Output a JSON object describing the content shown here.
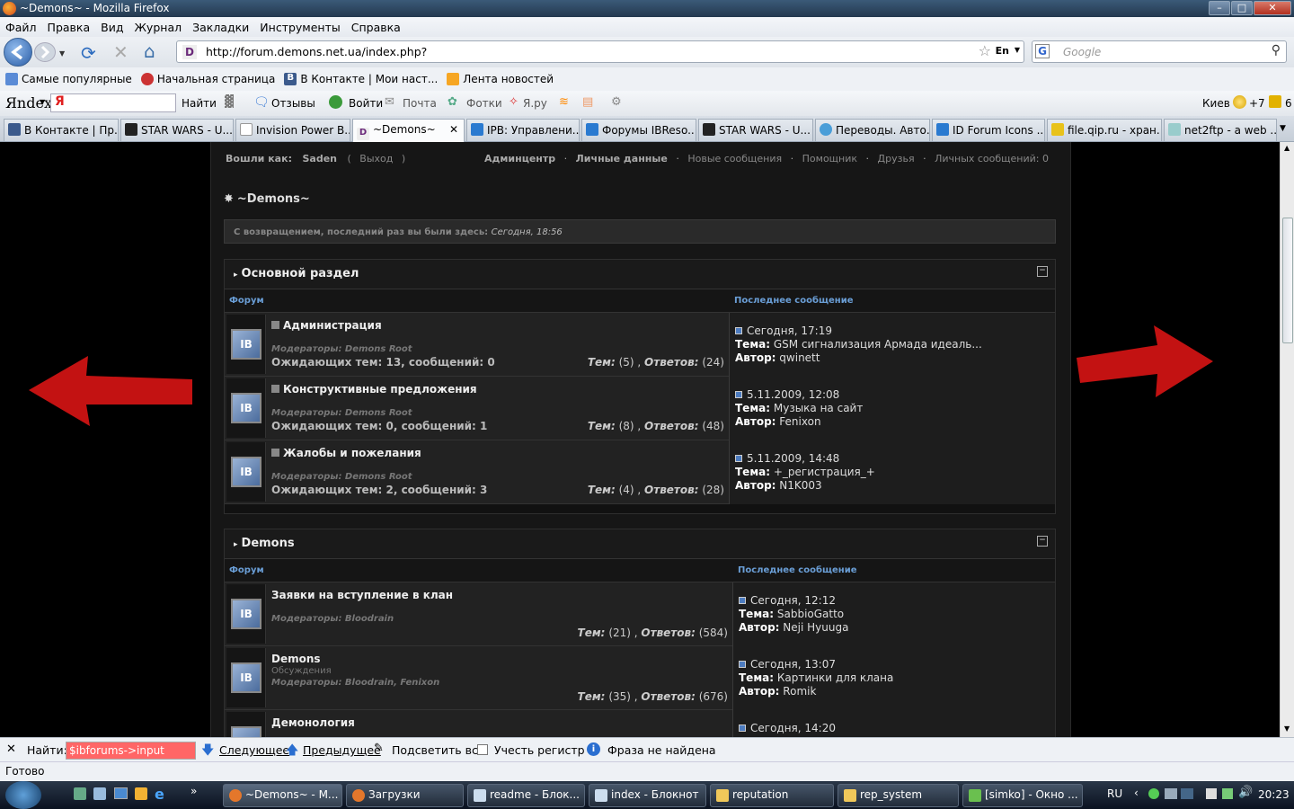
{
  "window": {
    "title": "~Demons~ - Mozilla Firefox"
  },
  "menu": [
    "Файл",
    "Правка",
    "Вид",
    "Журнал",
    "Закладки",
    "Инструменты",
    "Справка"
  ],
  "address": {
    "url": "http://forum.demons.net.ua/index.php?",
    "lang": "En"
  },
  "search": {
    "placeholder": "Google"
  },
  "bookmarks": [
    "Самые популярные",
    "Начальная страница",
    "В Контакте | Мои наст...",
    "Лента новостей"
  ],
  "yandex": {
    "logo": "Яndex",
    "ya": "Я",
    "find": "Найти",
    "reviews": "Отзывы",
    "login": "Войти",
    "mail": "Почта",
    "photos": "Фотки",
    "yaru": "Я.ру",
    "city": "Киев",
    "temp": "+7",
    "count": "6"
  },
  "tabs": [
    {
      "label": "В Контакте | Пр..."
    },
    {
      "label": "STAR WARS - U..."
    },
    {
      "label": "Invision Power B..."
    },
    {
      "label": "~Demons~"
    },
    {
      "label": "IPB: Управлени..."
    },
    {
      "label": "Форумы IBReso..."
    },
    {
      "label": "STAR WARS - U..."
    },
    {
      "label": "Переводы. Авто..."
    },
    {
      "label": "ID Forum Icons ..."
    },
    {
      "label": "file.qip.ru - хран..."
    },
    {
      "label": "net2ftp - a web ..."
    }
  ],
  "userbar": {
    "logged_label": "Вошли как:",
    "user": "Saden",
    "paren_open": "(",
    "logout": "Выход",
    "paren_close": ")",
    "admin": "Админцентр",
    "personal": "Личные данные",
    "new_posts": "Новые сообщения",
    "helper": "Помощник",
    "friends": "Друзья",
    "pm": "Личных сообщений: 0",
    "sep": "·"
  },
  "brand": "~Demons~",
  "welcome": {
    "text": "С возвращением, последний раз вы были здесь:",
    "time": "Сегодня, 18:56"
  },
  "categories": [
    {
      "title": "Основной раздел",
      "col_forum": "Форум",
      "col_last": "Последнее сообщение",
      "forums": [
        {
          "name": "Администрация",
          "mods": "Модераторы: Demons Root",
          "waiting": "Ожидающих тем: 13, сообщений: 0",
          "topics_label": "Тем:",
          "topics": "(5)",
          "replies_label": "Ответов:",
          "replies": "(24)",
          "last_date": "Сегодня, 17:19",
          "topic_label": "Тема:",
          "last_topic": "GSM сигнализация Армада идеаль...",
          "author_label": "Автор:",
          "last_author": "qwinett"
        },
        {
          "name": "Конструктивные предложения",
          "mods": "Модераторы: Demons Root",
          "waiting": "Ожидающих тем: 0, сообщений: 1",
          "topics_label": "Тем:",
          "topics": "(8)",
          "replies_label": "Ответов:",
          "replies": "(48)",
          "last_date": "5.11.2009, 12:08",
          "topic_label": "Тема:",
          "last_topic": "Музыка на сайт",
          "author_label": "Автор:",
          "last_author": "Fenixon"
        },
        {
          "name": "Жалобы и пожелания",
          "mods": "Модераторы: Demons Root",
          "waiting": "Ожидающих тем: 2, сообщений: 3",
          "topics_label": "Тем:",
          "topics": "(4)",
          "replies_label": "Ответов:",
          "replies": "(28)",
          "last_date": "5.11.2009, 14:48",
          "topic_label": "Тема:",
          "last_topic": "+_регистрация_+",
          "author_label": "Автор:",
          "last_author": "N1K003"
        }
      ]
    },
    {
      "title": "Demons",
      "col_forum": "Форум",
      "col_last": "Последнее сообщение",
      "forums": [
        {
          "name": "Заявки на вступление в клан",
          "mods": "Модераторы: Bloodrain",
          "topics_label": "Тем:",
          "topics": "(21)",
          "replies_label": "Ответов:",
          "replies": "(584)",
          "last_date": "Сегодня, 12:12",
          "topic_label": "Тема:",
          "last_topic": "SabbioGatto",
          "author_label": "Автор:",
          "last_author": "Neji Hyuuga"
        },
        {
          "name": "Demons",
          "desc": "Обсуждения",
          "mods": "Модераторы: Bloodrain, Fenixon",
          "topics_label": "Тем:",
          "topics": "(35)",
          "replies_label": "Ответов:",
          "replies": "(676)",
          "last_date": "Сегодня, 13:07",
          "topic_label": "Тема:",
          "last_topic": "Картинки для клана",
          "author_label": "Автор:",
          "last_author": "Romik"
        },
        {
          "name": "Демонология",
          "last_date": "Сегодня, 14:20"
        }
      ]
    }
  ],
  "findbar": {
    "label": "Найти:",
    "value": "$ibforums->input",
    "next": "Следующее",
    "prev": "Предыдущее",
    "highlight": "Подсветить все",
    "case": "Учесть регистр",
    "status": "Фраза не найдена"
  },
  "statusbar": "Готово",
  "taskbar": {
    "items": [
      "~Demons~ - M...",
      "Загрузки",
      "readme - Блок...",
      "index - Блокнот",
      "reputation",
      "rep_system",
      "[simko] - Окно ..."
    ],
    "lang": "RU",
    "clock": "20:23"
  }
}
